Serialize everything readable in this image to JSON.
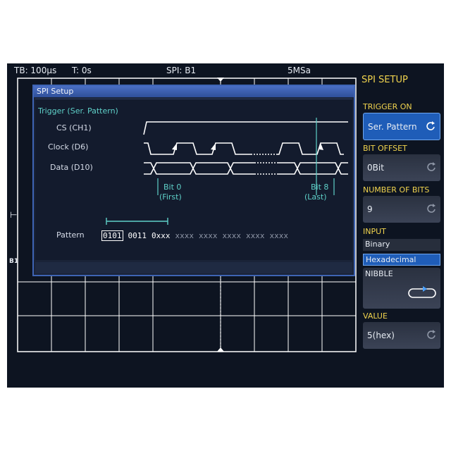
{
  "status": {
    "timebase": "TB: 100µs",
    "trigger_time": "T: 0s",
    "bus": "SPI: B1",
    "sample_rate": "5MSa"
  },
  "markers": {
    "bus_marker": "B1"
  },
  "dialog": {
    "title": "SPI Setup",
    "trigger_heading": "Trigger (Ser. Pattern)",
    "signals": [
      "CS (CH1)",
      "Clock (D6)",
      "Data (D10)"
    ],
    "bit_first_label": "Bit 0",
    "bit_first_sub": "(First)",
    "bit_last_label": "Bit 8",
    "bit_last_sub": "(Last)",
    "pattern_label": "Pattern",
    "pattern": [
      "0101",
      "0011",
      "0xxx",
      "xxxx",
      "xxxx",
      "xxxx",
      "xxxx",
      "xxxx"
    ]
  },
  "menu": {
    "title": "SPI SETUP",
    "trigger_on_label": "TRIGGER ON",
    "trigger_on_value": "Ser. Pattern",
    "bit_offset_label": "BIT OFFSET",
    "bit_offset_value": "0Bit",
    "number_of_bits_label": "NUMBER OF BITS",
    "number_of_bits_value": "9",
    "input_label": "INPUT",
    "input_options": [
      "Binary",
      "Hexadecimal",
      "NIBBLE"
    ],
    "input_selected": "Hexadecimal",
    "value_label": "VALUE",
    "value_value": "5(hex)"
  },
  "colors": {
    "screen_bg": "#0d1421",
    "menu_accent": "#f1d44e",
    "selection_blue": "#1f5db8",
    "dialog_cyan": "#5fd1c9"
  }
}
